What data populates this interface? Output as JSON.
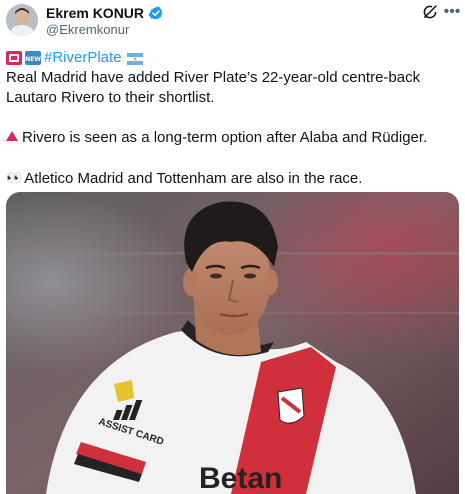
{
  "author": {
    "display_name": "Ekrem KONUR",
    "handle": "@Ekremkonur",
    "verified_badge": "verified-badge-icon"
  },
  "actions": {
    "grok_icon": "grok-icon",
    "more_icon": "more-options-icon",
    "more_label": "•••"
  },
  "tweet": {
    "hashtag": "#RiverPlate",
    "line1": "Real Madrid have added River Plate’s 22-year-old centre-back Lautaro Rivero to their shortlist.",
    "line2": "Rivero is seen as a long-term option after Alaba and Rüdiger.",
    "line3": "Atletico Madrid and Tottenham are also in the race.",
    "eyes_emoji": "👀"
  },
  "media": {
    "sponsor_text": "Betan",
    "sleeve_text": "ASSIST CARD",
    "photo_subject": "river-plate-player-photo"
  },
  "colors": {
    "link": "#1d9bf0",
    "verified": "#1d9bf0",
    "secondary_text": "#536471",
    "alert_red": "#e0245e"
  }
}
